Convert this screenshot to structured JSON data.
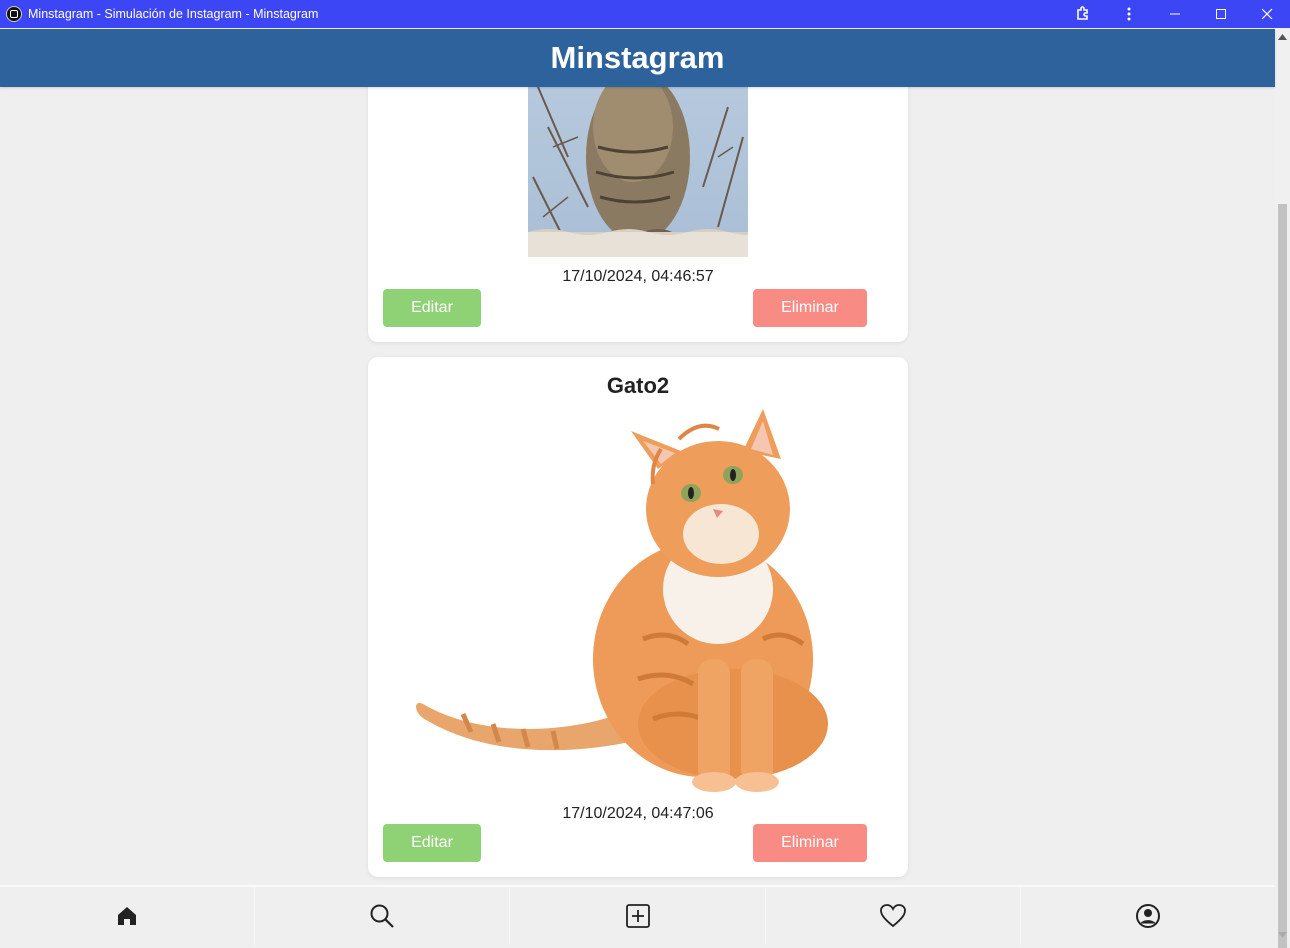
{
  "window": {
    "title": "Minstagram - Simulación de Instagram - Minstagram",
    "controls": [
      "extension-icon",
      "more-icon",
      "minimize-icon",
      "maximize-icon",
      "close-icon"
    ]
  },
  "header": {
    "title": "Minstagram"
  },
  "posts": [
    {
      "title": "",
      "image": "tabby-cat-photo",
      "timestamp": "17/10/2024, 04:46:57",
      "edit_label": "Editar",
      "delete_label": "Eliminar"
    },
    {
      "title": "Gato2",
      "image": "orange-cat-photo",
      "timestamp": "17/10/2024, 04:47:06",
      "edit_label": "Editar",
      "delete_label": "Eliminar"
    }
  ],
  "bottom_nav": [
    "home-icon",
    "search-icon",
    "add-post-icon",
    "heart-icon",
    "profile-icon"
  ],
  "colors": {
    "titlebar": "#3d46f5",
    "header": "#2e629c",
    "edit_button": "#8fd175",
    "delete_button": "#f98b85",
    "background": "#efefef"
  }
}
